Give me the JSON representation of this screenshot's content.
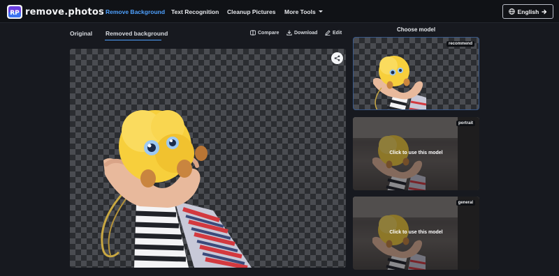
{
  "brand": {
    "name": "remove.photos",
    "mark": "RP"
  },
  "nav": {
    "items": [
      "Remove Background",
      "Text Recognition",
      "Cleanup Pictures",
      "More Tools"
    ],
    "active": "Remove Background",
    "language_button": "English"
  },
  "editor": {
    "tabs": [
      "Original",
      "Removed background"
    ],
    "active_tab": "Removed background",
    "actions": [
      "Compare",
      "Download",
      "Edit"
    ]
  },
  "models": {
    "title": "Choose model",
    "cards": [
      {
        "tag": "recommend",
        "selected": true
      },
      {
        "tag": "portrait",
        "cta": "Click to use this model"
      },
      {
        "tag": "general",
        "cta": "Click to use this model"
      }
    ]
  },
  "colors": {
    "background": "#17191f",
    "topbar": "#101216",
    "accent": "#4ea1ff",
    "subject_yellow": "#f7cf3c"
  },
  "icons": {
    "compare": "compare-icon",
    "download": "download-icon",
    "edit": "edit-icon",
    "share": "share-icon",
    "globe": "globe-icon",
    "arrow": "arrow-right-icon",
    "caret": "chevron-down-icon"
  }
}
